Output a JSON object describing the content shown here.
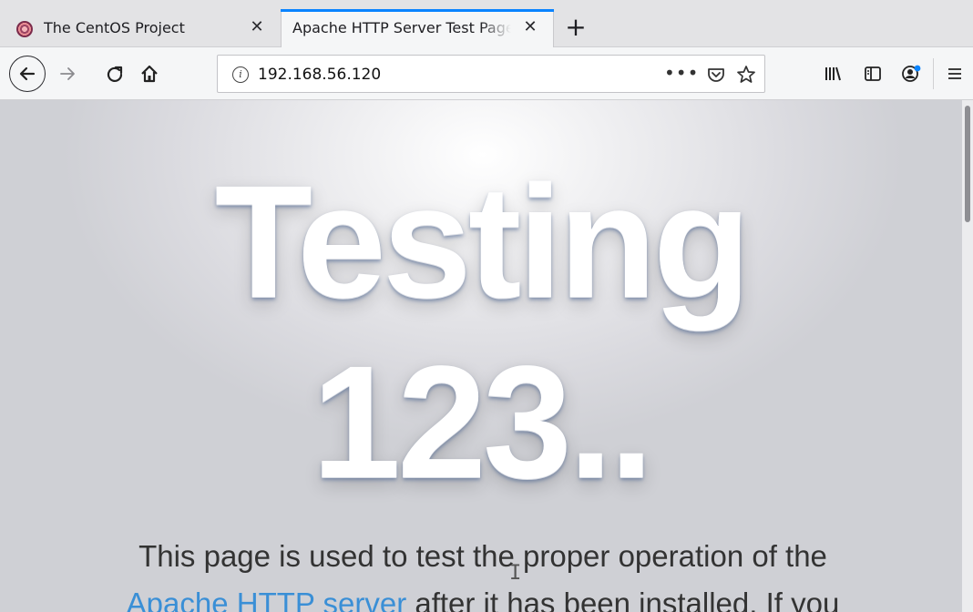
{
  "tabs": [
    {
      "title": "The CentOS Project",
      "close": "✕",
      "active": false,
      "favicon": "centos-icon"
    },
    {
      "title": "Apache HTTP Server Test Page powered by CentOS",
      "close": "✕",
      "active": true
    }
  ],
  "newtab_label": "+",
  "nav": {
    "url": "192.168.56.120",
    "more_label": "•••",
    "icons": [
      "back-icon",
      "forward-icon",
      "reload-icon",
      "home-icon",
      "info-icon",
      "pocket-icon",
      "star-icon",
      "library-icon",
      "sidebar-icon",
      "account-icon",
      "menu-icon"
    ]
  },
  "page": {
    "hero_line1": "Testing",
    "hero_line2": "123..",
    "intro_line1": "This page is used to test the proper operation of the",
    "intro_link": "Apache HTTP server",
    "intro_line2_rest": " after it has been installed. If you"
  },
  "colors": {
    "accent": "#0a84ff",
    "link": "#3a8fd6"
  }
}
